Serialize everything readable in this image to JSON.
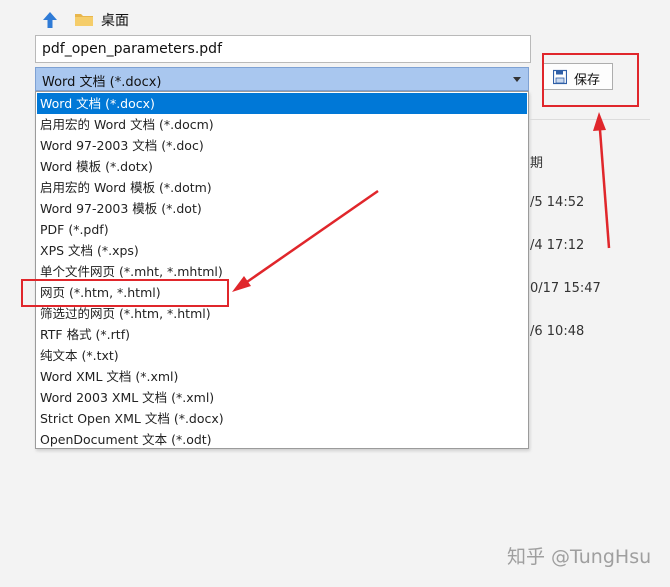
{
  "nav": {
    "location": "桌面"
  },
  "file_name": {
    "value": "pdf_open_parameters.pdf"
  },
  "file_type": {
    "selected": "Word 文档 (*.docx)",
    "options": [
      "Word 文档 (*.docx)",
      "启用宏的 Word 文档 (*.docm)",
      "Word 97-2003 文档 (*.doc)",
      "Word 模板 (*.dotx)",
      "启用宏的 Word 模板 (*.dotm)",
      "Word 97-2003 模板 (*.dot)",
      "PDF (*.pdf)",
      "XPS 文档 (*.xps)",
      "单个文件网页 (*.mht, *.mhtml)",
      "网页 (*.htm, *.html)",
      "筛选过的网页 (*.htm, *.html)",
      "RTF 格式 (*.rtf)",
      "纯文本 (*.txt)",
      "Word XML 文档 (*.xml)",
      "Word 2003 XML 文档 (*.xml)",
      "Strict Open XML 文档 (*.docx)",
      "OpenDocument 文本 (*.odt)"
    ]
  },
  "save_button": {
    "label": "保存"
  },
  "file_list": {
    "column_header": "期",
    "dates": [
      "/5 14:52",
      "/4 17:12",
      "0/17 15:47",
      "/6 10:48"
    ]
  },
  "watermark": "知乎 @TungHsu",
  "colors": {
    "selected_row": "#0078d7",
    "select_box": "#a9c7ef",
    "annotation": "#e0262b",
    "up_arrow": "#2f7bd6",
    "folder": "#e8b64c"
  }
}
